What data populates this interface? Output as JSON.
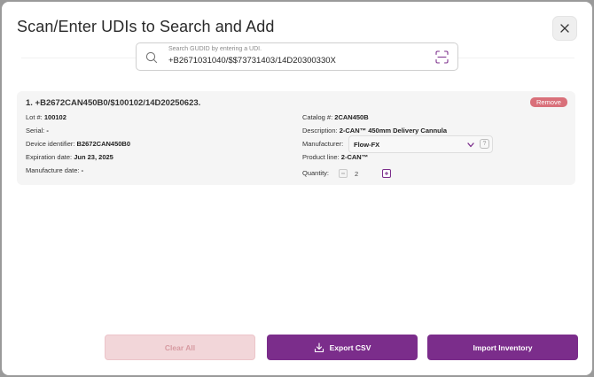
{
  "modal": {
    "title": "Scan/Enter UDIs to Search and Add"
  },
  "search": {
    "placeholder": "Search GUDID by entering a UDI.",
    "value": "+B2671031040/$$73731403/14D20300330X"
  },
  "item": {
    "heading": "1. +B2672CAN450B0/$100102/14D20250623.",
    "remove_label": "Remove",
    "lot_label": "Lot #:",
    "lot_value": "100102",
    "serial_label": "Serial:",
    "serial_value": "-",
    "device_id_label": "Device identifier:",
    "device_id_value": "B2672CAN450B0",
    "expiration_label": "Expiration date:",
    "expiration_value": "Jun 23, 2025",
    "manufacture_label": "Manufacture date:",
    "manufacture_value": "-",
    "catalog_label": "Catalog #:",
    "catalog_value": "2CAN450B",
    "description_label": "Description:",
    "description_value": "2-CAN™ 450mm Delivery Cannula",
    "manufacturer_label": "Manufacturer:",
    "manufacturer_value": "Flow-FX",
    "product_line_label": "Product line:",
    "product_line_value": "2-CAN™",
    "quantity_label": "Quantity:",
    "quantity_value": "2"
  },
  "actions": {
    "clear_label": "Clear All",
    "export_label": "Export CSV",
    "import_label": "Import Inventory"
  },
  "colors": {
    "primary": "#7b2d8b",
    "remove": "#d9707a",
    "clear_bg": "#f2d6d9"
  }
}
